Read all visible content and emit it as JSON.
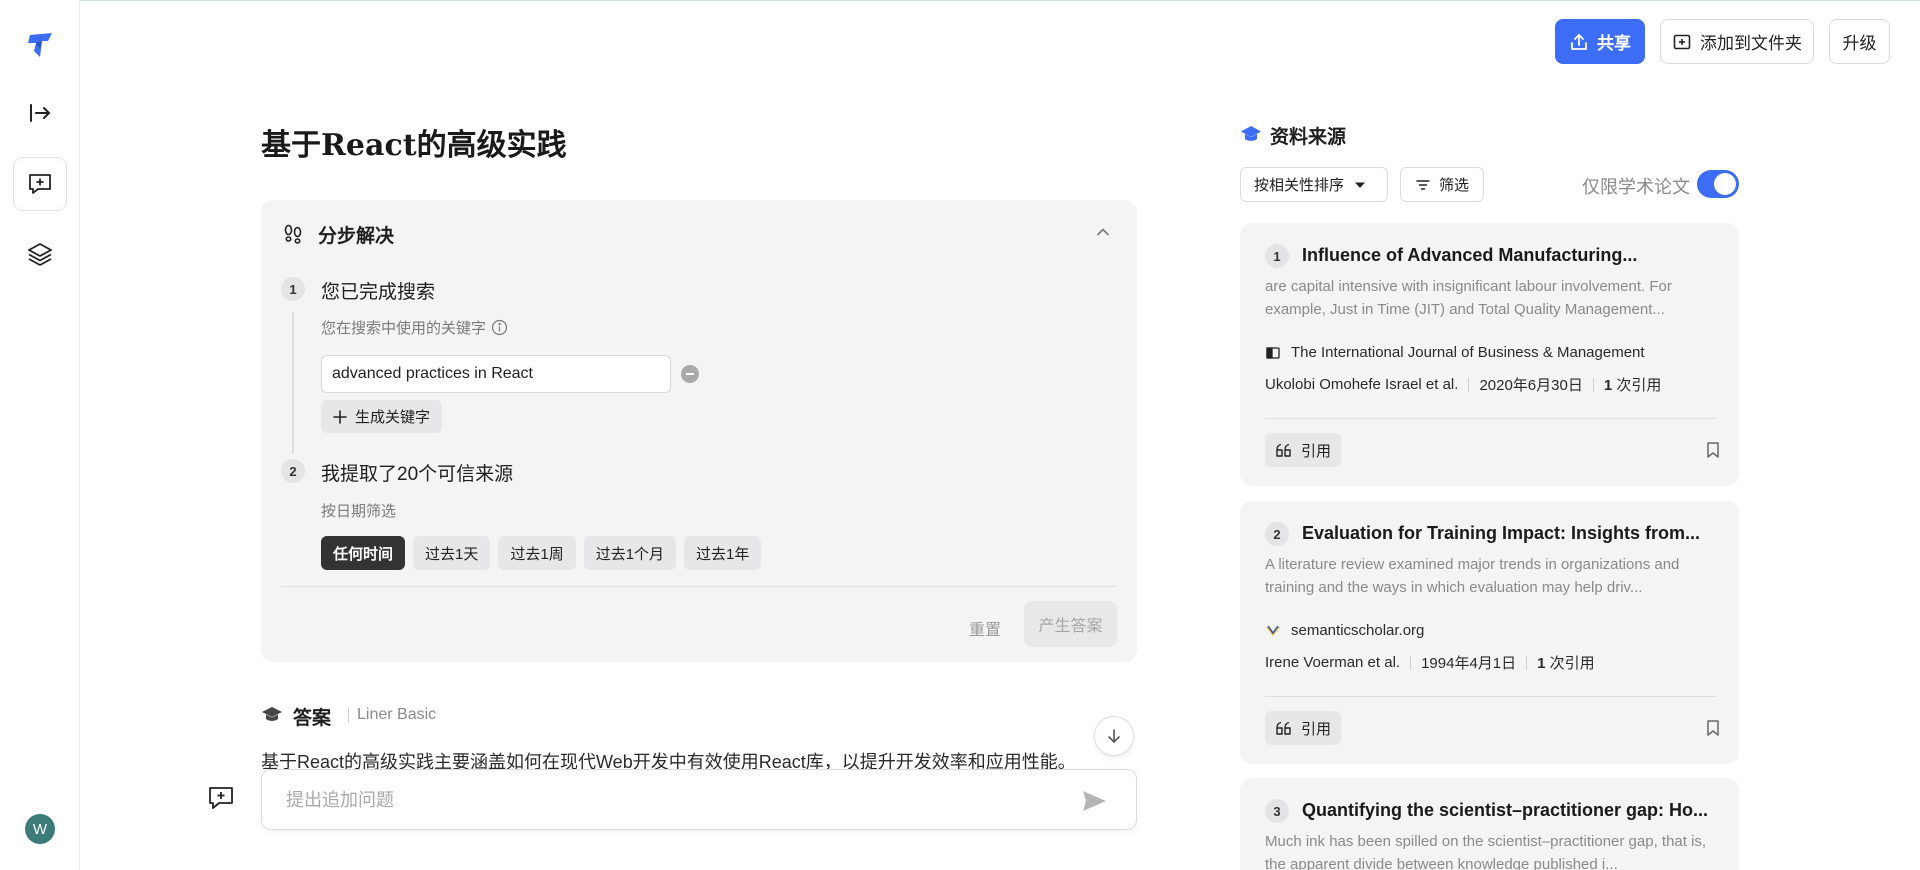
{
  "header": {
    "share_label": "共享",
    "add_folder_label": "添加到文件夹",
    "upgrade_label": "升级"
  },
  "user": {
    "avatar_initial": "W"
  },
  "page": {
    "title": "基于React的高级实践"
  },
  "steps": {
    "title": "分步解决",
    "step1": {
      "number": "1",
      "title": "您已完成搜索",
      "keywords_label": "您在搜索中使用的关键字",
      "keyword_value": "advanced practices in React",
      "generate_keywords_label": "生成关键字"
    },
    "step2": {
      "number": "2",
      "title": "我提取了20个可信来源",
      "date_filter_label": "按日期筛选",
      "date_options": [
        "任何时间",
        "过去1天",
        "过去1周",
        "过去1个月",
        "过去1年"
      ],
      "date_selected": "任何时间"
    },
    "reset_label": "重置",
    "generate_answer_label": "产生答案"
  },
  "answer": {
    "title": "答案",
    "model": "Liner Basic",
    "text": "基于React的高级实践主要涵盖如何在现代Web开发中有效使用React库，以提升开发效率和应用性能。"
  },
  "ask": {
    "placeholder": "提出追加问题"
  },
  "sources": {
    "title": "资料来源",
    "sort_label": "按相关性排序",
    "filter_label": "筛选",
    "academic_only_label": "仅限学术论文",
    "academic_only_enabled": true,
    "cite_label": "引用",
    "items": [
      {
        "number": "1",
        "title": "Influence of Advanced Manufacturing...",
        "snippet": "are capital intensive with insignificant labour involvement. For example, Just in Time (JIT) and Total Quality Management...",
        "venue": "The International Journal of Business & Management",
        "authors": "Ukolobi Omohefe Israel et al.",
        "date": "2020年6月30日",
        "citations": "1",
        "citations_suffix": "次引用"
      },
      {
        "number": "2",
        "title": "Evaluation for Training Impact: Insights from...",
        "snippet": "A literature review examined major trends in organizations and training and the ways in which evaluation may help driv...",
        "venue": "semanticscholar.org",
        "authors": "Irene Voerman et al.",
        "date": "1994年4月1日",
        "citations": "1",
        "citations_suffix": "次引用"
      },
      {
        "number": "3",
        "title": "Quantifying the scientist–practitioner gap: Ho...",
        "snippet": "Much ink has been spilled on the scientist–practitioner gap, that is, the apparent divide between knowledge published i..."
      }
    ]
  },
  "colors": {
    "accent": "#3d6cf5",
    "panel_bg": "#f4f4f5",
    "avatar_bg": "#3b7c7a",
    "chip_active_bg": "#333333"
  }
}
